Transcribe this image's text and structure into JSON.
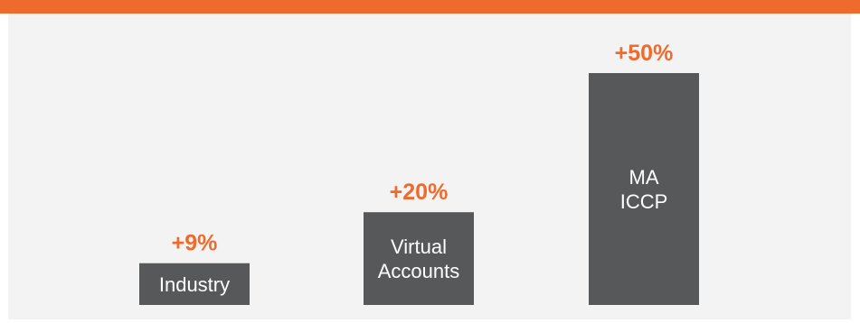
{
  "colors": {
    "accent": "#ef6b2d",
    "bar": "#57585a",
    "panel_background": "#f3f3f3"
  },
  "chart_data": {
    "type": "bar",
    "title": "",
    "xlabel": "",
    "ylabel": "",
    "ylim": [
      0,
      50
    ],
    "grid": false,
    "categories": [
      "Industry",
      "Virtual Accounts",
      "MA ICCP"
    ],
    "category_label_lines": [
      [
        "Industry"
      ],
      [
        "Virtual",
        "Accounts"
      ],
      [
        "MA",
        "ICCP"
      ]
    ],
    "values": [
      9,
      20,
      50
    ],
    "data_labels": [
      "+9%",
      "+20%",
      "+50%"
    ]
  }
}
